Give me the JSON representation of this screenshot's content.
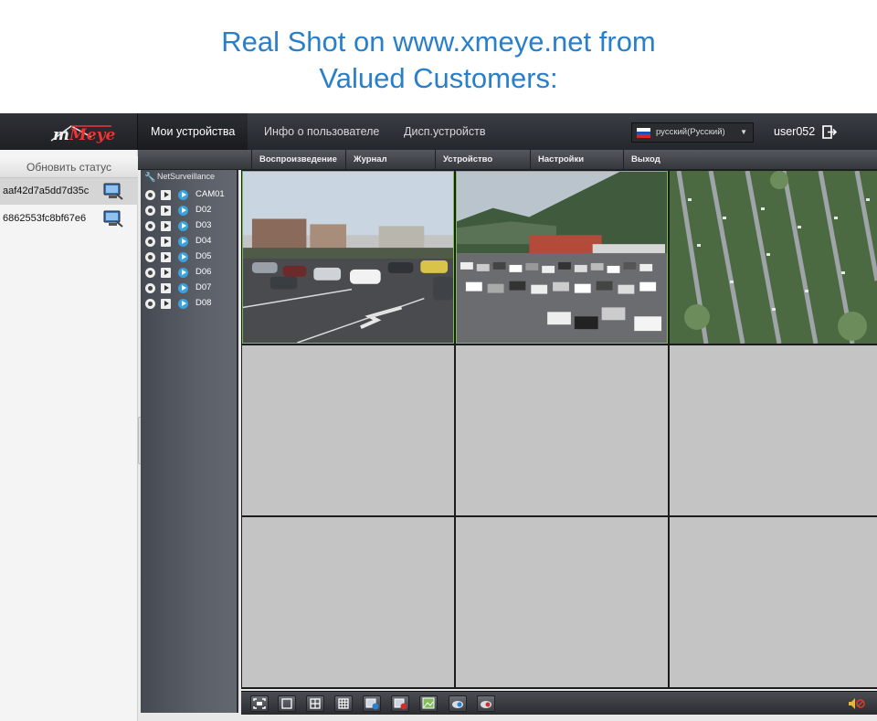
{
  "banner": {
    "line1": "Real Shot on www.xmeye.net from",
    "line2": "Valued Customers:"
  },
  "app": {
    "logo_text": "Meye",
    "nav": {
      "devices": "Мои устройства",
      "user_info": "Инфо о пользователе",
      "device_manager": "Дисп.устройств"
    },
    "language": "русский(Русский)",
    "username": "user052",
    "separator": "|",
    "subnav": [
      "Воспроизведение",
      "Журнал",
      "Устройство",
      "Настройки",
      "Выход"
    ],
    "refresh_status": "Обновить статус",
    "devices": [
      {
        "id": "aaf42d7a5dd7d35c",
        "selected": true
      },
      {
        "id": "6862553fc8bf67e6",
        "selected": false
      }
    ],
    "tree": {
      "root": "NetSurveillance",
      "channels": [
        "CAM01",
        "D02",
        "D03",
        "D04",
        "D05",
        "D06",
        "D07",
        "D08"
      ]
    },
    "collapse_label": "«",
    "colors": {
      "banner_text": "#2a7fc9",
      "nav_bg": "#2b2e33",
      "active_cell_border": "#7bc043",
      "empty_cell": "#c4c4c4"
    },
    "toolbar_icons": [
      "fullscreen-icon",
      "single-view-icon",
      "quad-view-icon",
      "nine-view-icon",
      "record-icon",
      "stop-record-icon",
      "snapshot-icon",
      "talk-icon",
      "close-video-icon"
    ]
  }
}
